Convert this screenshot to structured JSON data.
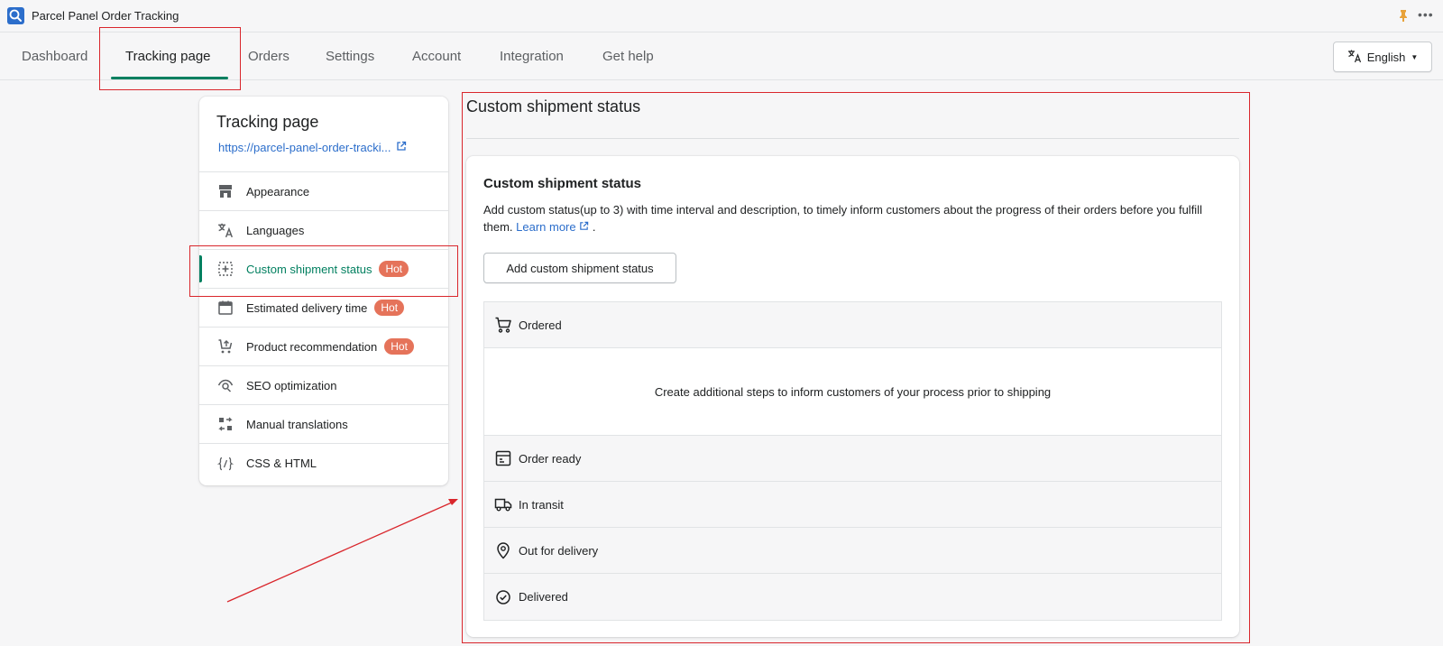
{
  "app": {
    "title": "Parcel Panel Order Tracking",
    "logo_icon": "search-icon",
    "accent": "#008060",
    "link_color": "#2c6ecb",
    "hot_color": "#e5735a",
    "annotation_color": "#d9262c"
  },
  "nav": {
    "tabs": [
      {
        "label": "Dashboard"
      },
      {
        "label": "Tracking page"
      },
      {
        "label": "Orders"
      },
      {
        "label": "Settings"
      },
      {
        "label": "Account"
      },
      {
        "label": "Integration"
      },
      {
        "label": "Get help"
      }
    ],
    "active_tab": "Tracking page",
    "language": {
      "label": "English",
      "icon": "translate-icon"
    }
  },
  "sidebar": {
    "title": "Tracking page",
    "url": "https://parcel-panel-order-tracki...",
    "url_icon": "external-link-icon",
    "badge_label": "Hot",
    "items": [
      {
        "label": "Appearance",
        "icon": "store-icon"
      },
      {
        "label": "Languages",
        "icon": "translate-icon"
      },
      {
        "label": "Custom shipment status",
        "icon": "add-square-icon",
        "hot": true,
        "active": true
      },
      {
        "label": "Estimated delivery time",
        "icon": "calendar-icon",
        "hot": true
      },
      {
        "label": "Product recommendation",
        "icon": "cart-up-icon",
        "hot": true
      },
      {
        "label": "SEO optimization",
        "icon": "eye-icon"
      },
      {
        "label": "Manual translations",
        "icon": "swap-icon"
      },
      {
        "label": "CSS & HTML",
        "icon": "code-icon"
      }
    ]
  },
  "main": {
    "title": "Custom shipment status",
    "card": {
      "title": "Custom shipment status",
      "description": "Add custom status(up to 3) with time interval and description, to timely inform customers about the progress of their orders before you fulfill them.",
      "learn_more": "Learn more",
      "description_end": ".",
      "add_button": "Add custom shipment status",
      "empty_message": "Create additional steps to inform customers of your process prior to shipping",
      "statuses": [
        {
          "label": "Ordered",
          "icon": "cart-icon"
        },
        {
          "label": "Order ready",
          "icon": "box-icon"
        },
        {
          "label": "In transit",
          "icon": "truck-icon"
        },
        {
          "label": "Out for delivery",
          "icon": "location-pin-icon"
        },
        {
          "label": "Delivered",
          "icon": "check-circle-icon"
        }
      ]
    }
  }
}
